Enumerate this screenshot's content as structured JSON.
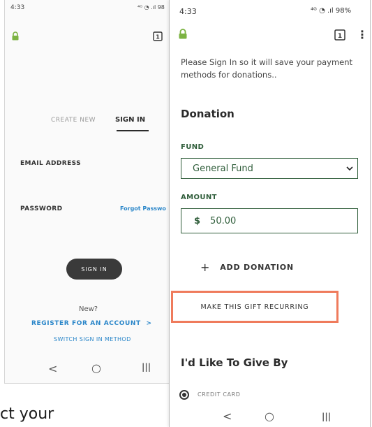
{
  "left_screen": {
    "status_time": "4:33",
    "status_icons": "⁴ᴳ ◔ .ıl 98",
    "tab_create": "CREATE NEW",
    "tab_signin": "SIGN IN",
    "email_label": "EMAIL ADDRESS",
    "password_label": "PASSWORD",
    "forgot_password": "Forgot Passwo",
    "signin_button": "SIGN IN",
    "new_text": "New?",
    "register_link": "REGISTER FOR AN ACCOUNT",
    "register_arrow": ">",
    "switch_method": "SWITCH SIGN IN METHOD",
    "nav_back": "<",
    "nav_home": "○",
    "nav_recent": "|||"
  },
  "right_screen": {
    "status_time": "4:33",
    "status_icons": "⁴ᴳ ◔ .ıl 98%",
    "tab_count": "1",
    "menu_icon": "⋮",
    "intro_text": "Please Sign In so it will save your payment methods for donations..",
    "donation_heading": "Donation",
    "fund_label": "FUND",
    "fund_value": "General Fund",
    "fund_chevron": "⌄",
    "amount_label": "AMOUNT",
    "amount_currency": "$",
    "amount_value": "50.00",
    "add_donation_plus": "+",
    "add_donation": "ADD DONATION",
    "make_recurring": "MAKE THIS GIFT RECURRING",
    "give_by_heading": "I'd Like To Give By",
    "payment_option": "CREDIT CARD",
    "nav_back": "<",
    "nav_home": "○",
    "nav_recent": "|||"
  },
  "caption": "ct your",
  "colors": {
    "accent_green": "#2f5d3a",
    "lock_green": "#7cb342",
    "link_blue": "#2a86c9",
    "highlight_orange": "#ef7b5c"
  }
}
